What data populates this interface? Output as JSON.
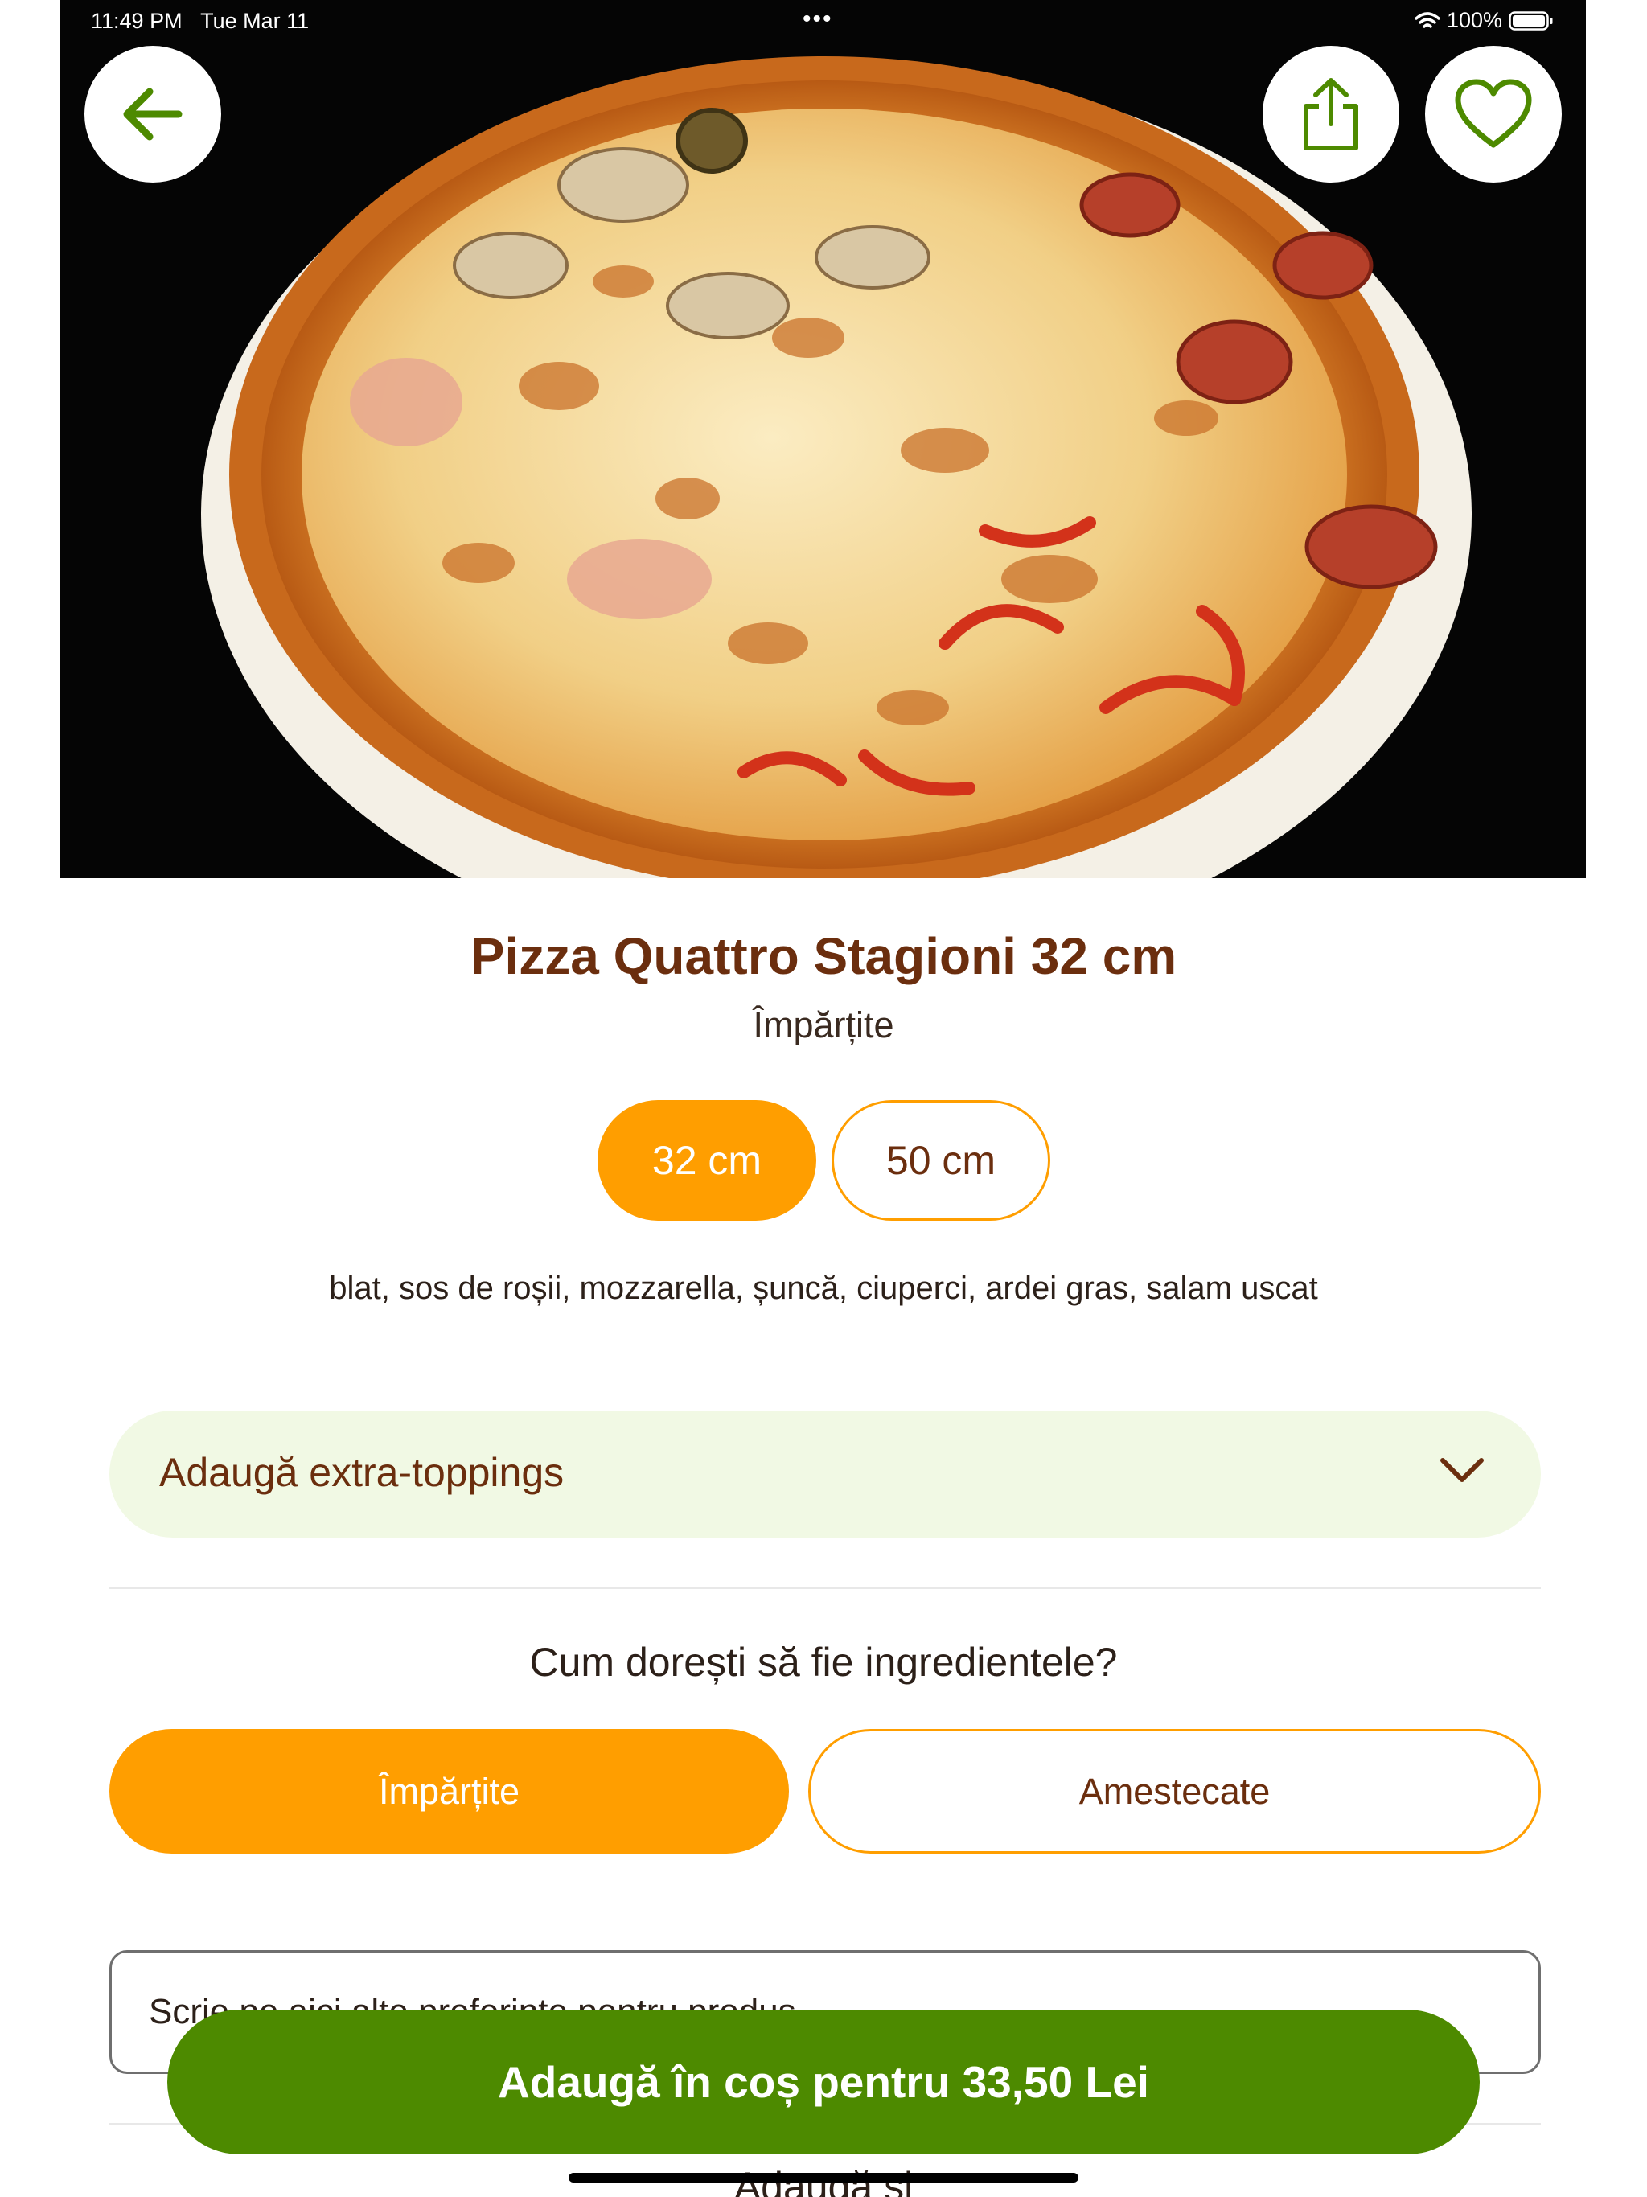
{
  "status_bar": {
    "time": "11:49 PM",
    "date": "Tue Mar 11",
    "dots": "•••",
    "battery": "100%"
  },
  "hero": {
    "image_icon": "pizza-photo",
    "back_icon": "arrow-left-icon",
    "share_icon": "share-icon",
    "favorite_icon": "heart-icon"
  },
  "product": {
    "title": "Pizza Quattro Stagioni 32 cm",
    "subtitle": "Împărțite",
    "sizes": [
      "32 cm",
      "50 cm"
    ],
    "selected_size": "32 cm",
    "ingredients": "blat, sos de roșii, mozzarella, șuncă, ciuperci, ardei gras, salam uscat"
  },
  "toppings": {
    "label": "Adaugă extra-toppings"
  },
  "ingredients_mode": {
    "question": "Cum dorești să fie ingredientele?",
    "options": [
      "Împărțite",
      "Amestecate"
    ],
    "selected": "Împărțite"
  },
  "notes": {
    "placeholder": "Scrie pe aici alte preferințe pentru produs"
  },
  "cart": {
    "button_label": "Adaugă în coș pentru 33,50 Lei"
  },
  "partial_section": {
    "label": "Adaugă și"
  },
  "colors": {
    "accent_orange": "#ff9e00",
    "brand_green": "#4d8a00",
    "title_brown": "#6b2e0e",
    "toppings_bg": "#f1f9e4"
  }
}
